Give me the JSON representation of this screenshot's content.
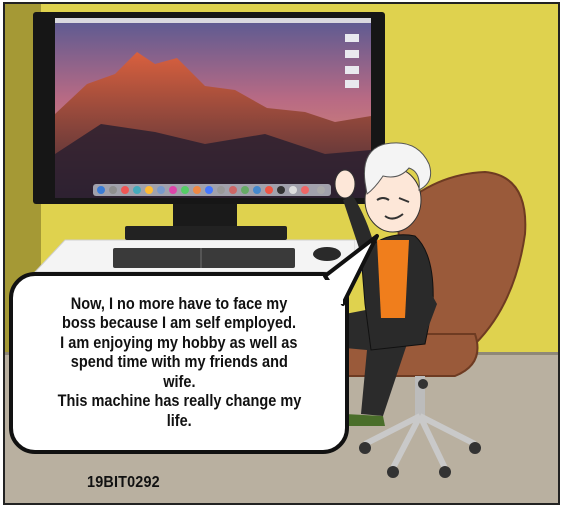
{
  "speech": {
    "lines": [
      "Now, I no more have to face my",
      "boss because I am self employed.",
      "I am enjoying my hobby as well as",
      "spend time with my friends and",
      "wife.",
      "This machine has really change my",
      "life."
    ]
  },
  "author_id": "19BIT0292",
  "scene": {
    "computer": "desktop-monitor",
    "character": "man-waving",
    "chair": "office-chair"
  },
  "colors": {
    "wall": "#dfd24e",
    "floor": "#b9b0a0",
    "chair": "#9a5a3a",
    "shirt": "#f07e1c",
    "jacket": "#2a2a2a"
  }
}
